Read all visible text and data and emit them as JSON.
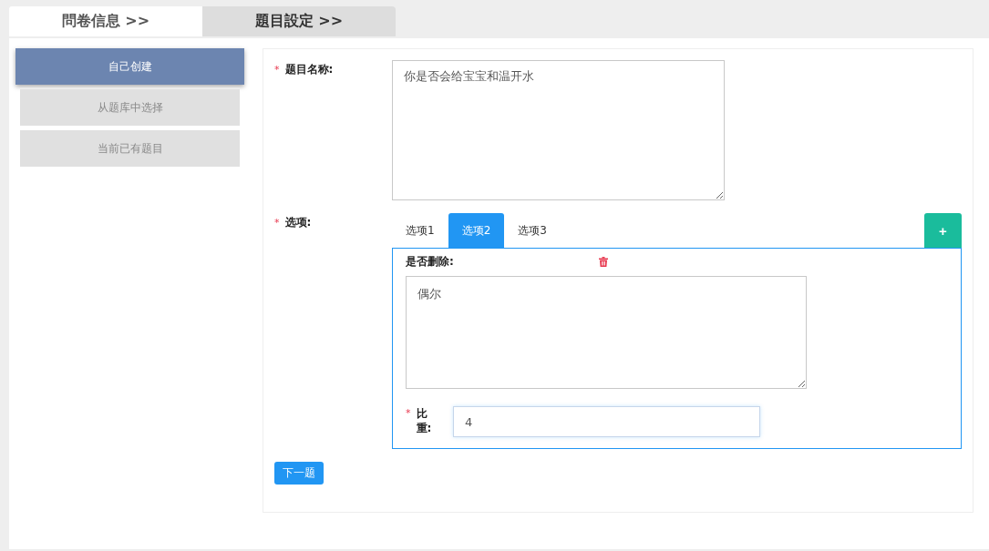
{
  "steps": [
    {
      "label": "問卷信息 >>",
      "selected": false
    },
    {
      "label": "題目設定 >>",
      "selected": true
    }
  ],
  "sidebar": {
    "items": [
      {
        "label": "自己创建",
        "selected": true
      },
      {
        "label": "从题库中选择",
        "selected": false
      },
      {
        "label": "当前已有题目",
        "selected": false
      }
    ]
  },
  "form": {
    "title_field": {
      "mark": "*",
      "label": "题目名称:",
      "value": "你是否会给宝宝和温开水"
    },
    "options": {
      "mark": "*",
      "label": "选项:",
      "add_button": "+",
      "tabs": [
        {
          "label": "选项1",
          "selected": false
        },
        {
          "label": "选项2",
          "selected": true
        },
        {
          "label": "选项3",
          "selected": false
        }
      ],
      "delete_label": "是否删除:",
      "option_text": "偶尔",
      "weight": {
        "mark": "*",
        "label": "比重:",
        "value": "4"
      }
    },
    "next_button": "下一题"
  }
}
